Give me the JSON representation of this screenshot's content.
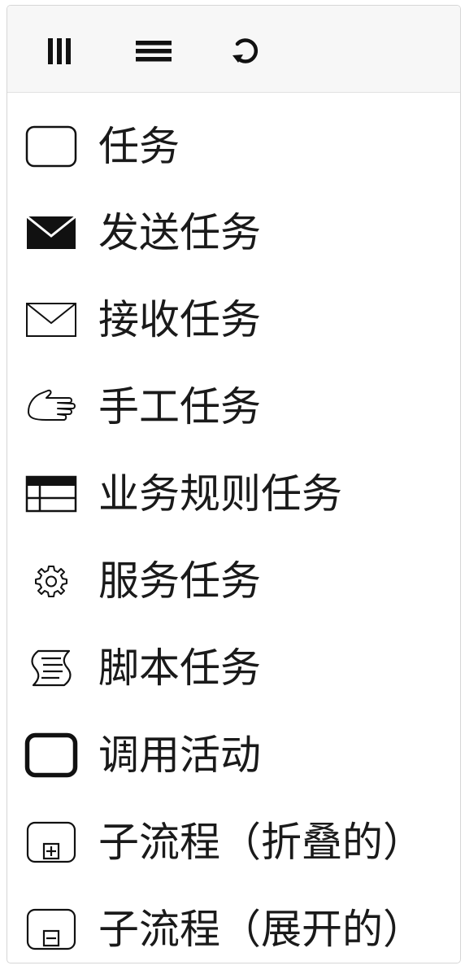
{
  "toolbar": {
    "buttons": [
      {
        "icon": "column-layout-icon"
      },
      {
        "icon": "list-layout-icon"
      },
      {
        "icon": "reset-icon"
      }
    ]
  },
  "items": [
    {
      "label": "任务",
      "icon": "task-icon"
    },
    {
      "label": "发送任务",
      "icon": "send-envelope-icon"
    },
    {
      "label": "接收任务",
      "icon": "receive-envelope-icon"
    },
    {
      "label": "手工任务",
      "icon": "hand-icon"
    },
    {
      "label": "业务规则任务",
      "icon": "business-rule-table-icon"
    },
    {
      "label": "服务任务",
      "icon": "gear-icon"
    },
    {
      "label": "脚本任务",
      "icon": "script-scroll-icon"
    },
    {
      "label": "调用活动",
      "icon": "call-activity-icon"
    },
    {
      "label": "子流程（折叠的）",
      "icon": "subprocess-collapsed-icon"
    },
    {
      "label": "子流程（展开的）",
      "icon": "subprocess-expanded-icon"
    }
  ]
}
